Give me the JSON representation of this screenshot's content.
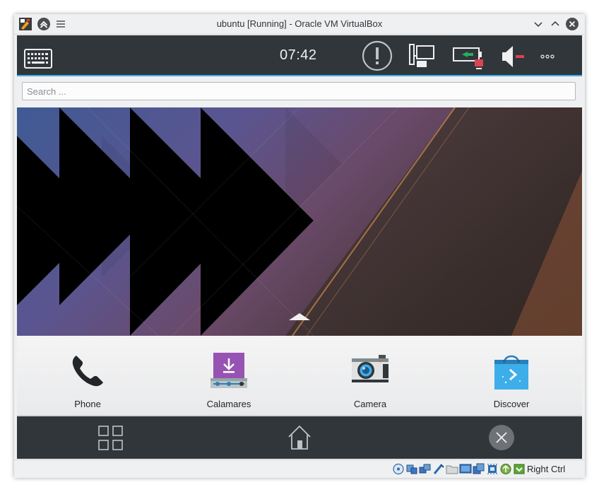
{
  "window": {
    "title": "ubuntu [Running] - Oracle VM VirtualBox"
  },
  "phone": {
    "clock": "07:42",
    "search": {
      "placeholder": "Search ...",
      "value": ""
    },
    "favorites": [
      {
        "label": "Phone",
        "icon": "phone-icon"
      },
      {
        "label": "Calamares",
        "icon": "calamares-installer-icon"
      },
      {
        "label": "Camera",
        "icon": "camera-icon"
      },
      {
        "label": "Discover",
        "icon": "discover-store-icon"
      }
    ],
    "top_icons": [
      "keyboard-icon",
      "notification-alert-icon",
      "network-wired-icon",
      "battery-icon",
      "volume-muted-icon",
      "more-icon"
    ],
    "nav_icons": [
      "task-switcher-icon",
      "home-icon",
      "close-icon"
    ]
  },
  "statusbar": {
    "host_key": "Right Ctrl"
  },
  "colors": {
    "panel": "#31363b",
    "accent": "#3daee9",
    "window_bg": "#eff0f1"
  }
}
